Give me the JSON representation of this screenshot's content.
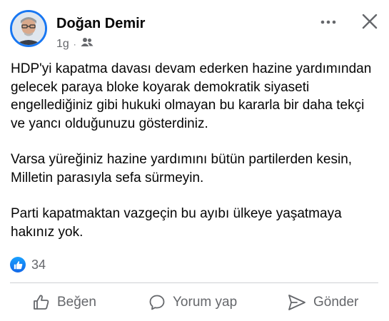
{
  "author": {
    "name": "Doğan Demir",
    "time": "1g",
    "audience_icon": "friends-icon"
  },
  "post": {
    "paragraphs": [
      "HDP'yi kapatma davası devam ederken hazine yardımından gelecek paraya bloke koyarak demokratik siyaseti engellediğiniz gibi hukuki olmayan bu kararla bir daha tekçi ve yancı olduğunuzu gösterdiniz.",
      "Varsa yüreğiniz hazine yardımını bütün partilerden kesin, Milletin parasıyla sefa sürmeyin.",
      "Parti kapatmaktan vazgeçin bu ayıbı ülkeye yaşatmaya hakınız yok."
    ]
  },
  "reactions": {
    "count": "34",
    "icon": "like-reaction-icon"
  },
  "actions": {
    "like_label": "Beğen",
    "comment_label": "Yorum yap",
    "send_label": "Gönder"
  },
  "colors": {
    "accent": "#1877f2",
    "secondary_text": "#65676b",
    "divider": "#ced0d4"
  }
}
